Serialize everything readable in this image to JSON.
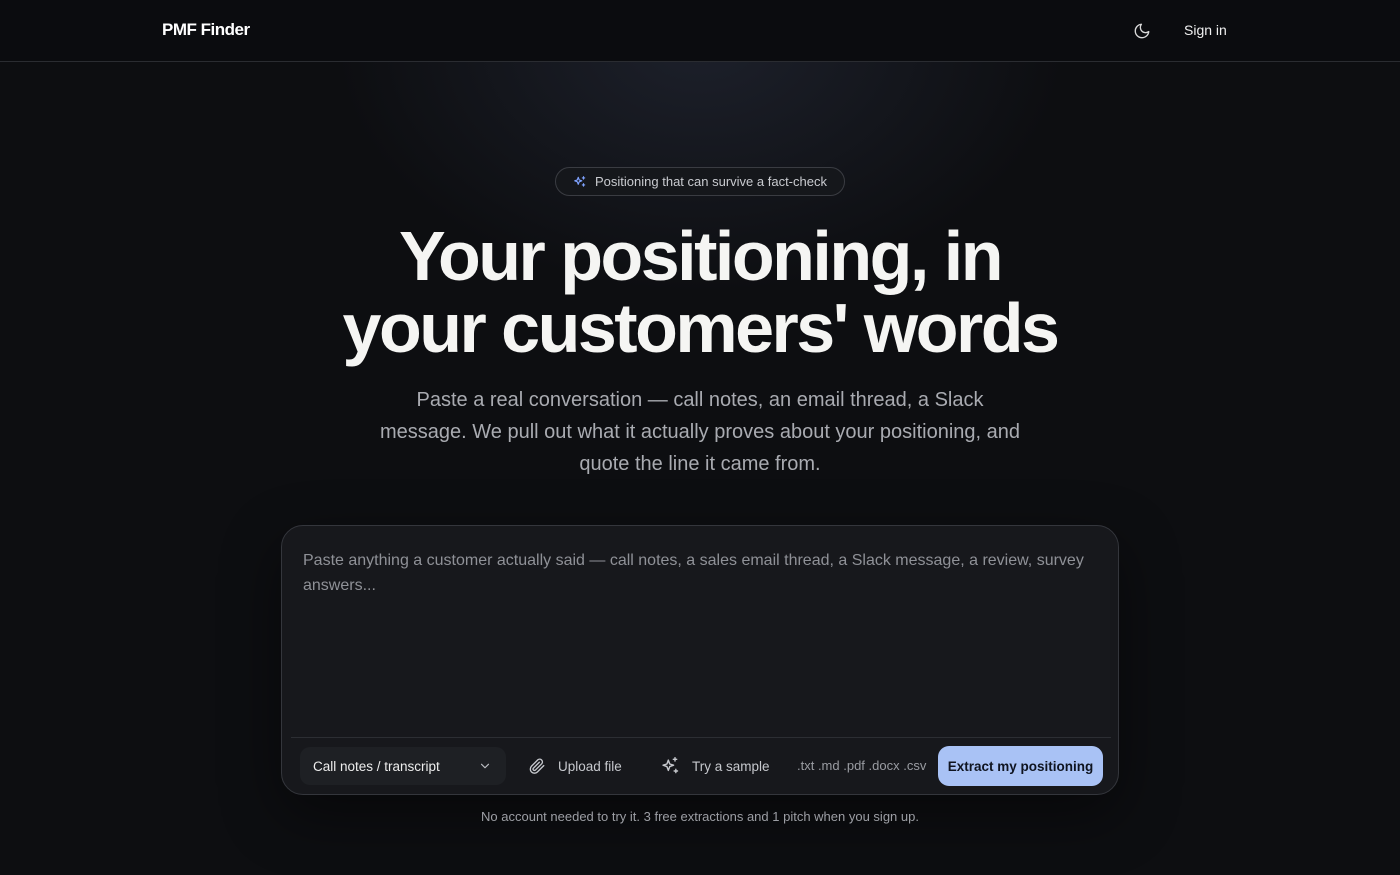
{
  "header": {
    "brand": "PMF Finder",
    "theme_icon": "moon-icon",
    "sign_in_label": "Sign in"
  },
  "hero": {
    "badge_icon": "sparkles-icon",
    "badge_text": "Positioning that can survive a fact-check",
    "title_line1": "Your positioning, in",
    "title_line2": "your customers' words",
    "subtitle": "Paste a real conversation — call notes, an email thread, a Slack message. We pull out what it actually proves about your positioning, and quote the line it came from."
  },
  "composer": {
    "placeholder": "Paste anything a customer actually said — call notes, a sales email thread, a Slack message, a review, survey answers...",
    "value": "",
    "source_type": {
      "selected": "Call notes / transcript",
      "icon": "chevron-down-icon"
    },
    "upload": {
      "label": "Upload file",
      "icon": "paperclip-icon"
    },
    "sample": {
      "label": "Try a sample",
      "icon": "sparkles-icon"
    },
    "formats": ".txt .md .pdf .docx .csv",
    "submit_label": "Extract my positioning"
  },
  "footnote": "No account needed to try it. 3 free extractions and 1 pitch when you sign up.",
  "colors": {
    "background": "#0d0e11",
    "card": "#17181c",
    "accent_button": "#a9c2f5",
    "badge_icon": "#7fa2ff"
  }
}
